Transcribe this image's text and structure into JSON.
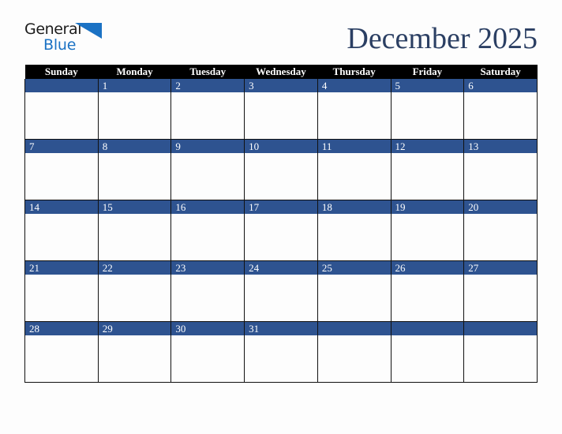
{
  "brand": {
    "name_part1": "General",
    "name_part2": "Blue",
    "triangle_icon": "blue-triangle-icon",
    "color_dark": "#1c1c1c",
    "color_blue": "#1b72c4"
  },
  "header": {
    "title": "December 2025",
    "title_color": "#2b3f63"
  },
  "calendar": {
    "month": "December",
    "year": "2025",
    "header_background": "#000000",
    "header_text_color": "#ffffff",
    "daynum_background": "#2e5390",
    "daynum_text_color": "#ffffff",
    "cell_background": "#fdfdfd",
    "border_color": "#111111",
    "weekday_headers": [
      "Sunday",
      "Monday",
      "Tuesday",
      "Wednesday",
      "Thursday",
      "Friday",
      "Saturday"
    ],
    "weeks": [
      [
        {
          "day": "",
          "filled": true
        },
        {
          "day": "1",
          "filled": true
        },
        {
          "day": "2",
          "filled": true
        },
        {
          "day": "3",
          "filled": true
        },
        {
          "day": "4",
          "filled": true
        },
        {
          "day": "5",
          "filled": true
        },
        {
          "day": "6",
          "filled": true
        }
      ],
      [
        {
          "day": "7",
          "filled": true
        },
        {
          "day": "8",
          "filled": true
        },
        {
          "day": "9",
          "filled": true
        },
        {
          "day": "10",
          "filled": true
        },
        {
          "day": "11",
          "filled": true
        },
        {
          "day": "12",
          "filled": true
        },
        {
          "day": "13",
          "filled": true
        }
      ],
      [
        {
          "day": "14",
          "filled": true
        },
        {
          "day": "15",
          "filled": true
        },
        {
          "day": "16",
          "filled": true
        },
        {
          "day": "17",
          "filled": true
        },
        {
          "day": "18",
          "filled": true
        },
        {
          "day": "19",
          "filled": true
        },
        {
          "day": "20",
          "filled": true
        }
      ],
      [
        {
          "day": "21",
          "filled": true
        },
        {
          "day": "22",
          "filled": true
        },
        {
          "day": "23",
          "filled": true
        },
        {
          "day": "24",
          "filled": true
        },
        {
          "day": "25",
          "filled": true
        },
        {
          "day": "26",
          "filled": true
        },
        {
          "day": "27",
          "filled": true
        }
      ],
      [
        {
          "day": "28",
          "filled": true
        },
        {
          "day": "29",
          "filled": true
        },
        {
          "day": "30",
          "filled": true
        },
        {
          "day": "31",
          "filled": true
        },
        {
          "day": "",
          "filled": true
        },
        {
          "day": "",
          "filled": true
        },
        {
          "day": "",
          "filled": true
        }
      ]
    ]
  }
}
